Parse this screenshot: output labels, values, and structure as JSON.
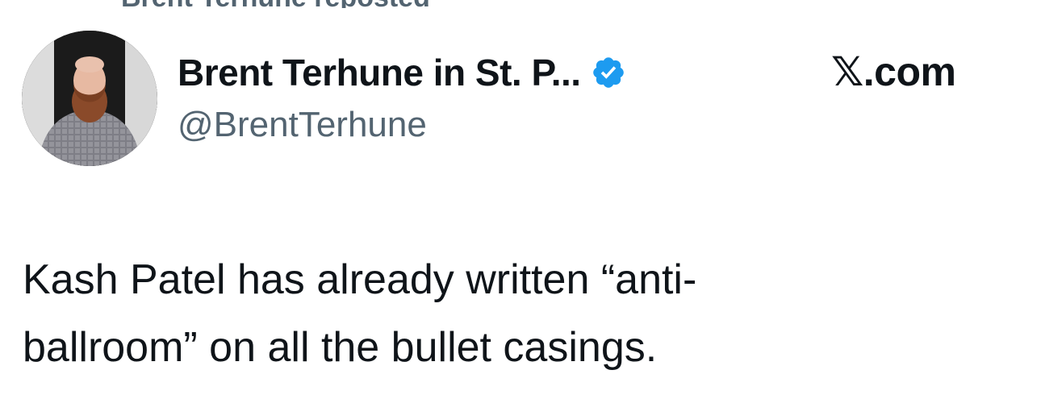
{
  "header": {
    "repost_text": "Brent Terhune reposted"
  },
  "author": {
    "display_name": "Brent Terhune in St. P...",
    "handle": "@BrentTerhune",
    "verified": true,
    "avatar_icon": "profile-photo",
    "badge_color": "#1d9bf0"
  },
  "source": {
    "label": "𝕏.com"
  },
  "tweet": {
    "lines": [
      "Kash Patel has already written “anti-",
      "ballroom” on all the bullet casings."
    ]
  },
  "colors": {
    "primary_text": "#0f1419",
    "secondary_text": "#536471",
    "background": "#ffffff"
  }
}
